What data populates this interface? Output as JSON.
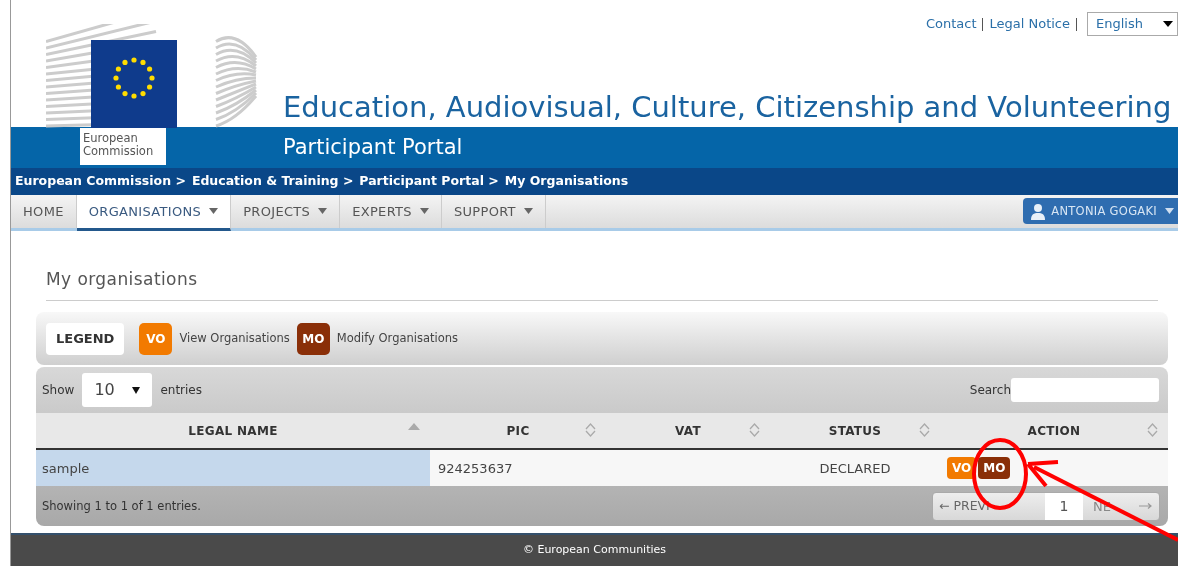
{
  "top_links": [
    {
      "label": "Contact"
    },
    {
      "label": "Legal Notice"
    }
  ],
  "language": {
    "value": "English"
  },
  "logo": {
    "line1": "European",
    "line2": "Commission"
  },
  "site_title": "Education, Audiovisual, Culture, Citizenship and Volunteering",
  "portal_title": "Participant Portal",
  "breadcrumb": [
    "European Commission >",
    "Education & Training >",
    "Participant Portal >",
    "My Organisations"
  ],
  "nav": [
    {
      "label": "HOME",
      "has_menu": false,
      "selected": false
    },
    {
      "label": "ORGANISATIONS",
      "has_menu": true,
      "selected": true
    },
    {
      "label": "PROJECTS",
      "has_menu": true,
      "selected": false
    },
    {
      "label": "EXPERTS",
      "has_menu": true,
      "selected": false
    },
    {
      "label": "SUPPORT",
      "has_menu": true,
      "selected": false
    }
  ],
  "user_menu": {
    "label": "ANTONIA GOGAKI"
  },
  "page_title": "My organisations",
  "legend": {
    "title": "LEGEND",
    "items": [
      {
        "badge": "VO",
        "label": "View Organisations",
        "color": "#f27a00"
      },
      {
        "badge": "MO",
        "label": "Modify Organisations",
        "color": "#8a2f08"
      }
    ]
  },
  "table": {
    "length": {
      "before": "Show",
      "value": "10",
      "after": "entries"
    },
    "search_label": "Search",
    "columns": [
      {
        "label": "LEGAL NAME",
        "sorted": true
      },
      {
        "label": "PIC",
        "sorted": false
      },
      {
        "label": "VAT",
        "sorted": false
      },
      {
        "label": "STATUS",
        "sorted": false
      },
      {
        "label": "ACTION",
        "sorted": false
      }
    ],
    "rows": [
      {
        "cells": [
          "sample",
          "924253637",
          "",
          "DECLARED"
        ],
        "actions": [
          {
            "badge": "VO",
            "color": "#f27a00"
          },
          {
            "badge": "MO",
            "color": "#8a2f08"
          }
        ]
      }
    ],
    "info": "Showing 1 to 1 of 1 entries.",
    "pagination": {
      "previous": {
        "label": "← PREVI",
        "disabled": true
      },
      "pages": [
        {
          "label": "1",
          "selected": true
        }
      ],
      "next": {
        "label": "NE",
        "disabled": true
      }
    }
  },
  "footer": "© European Communities"
}
